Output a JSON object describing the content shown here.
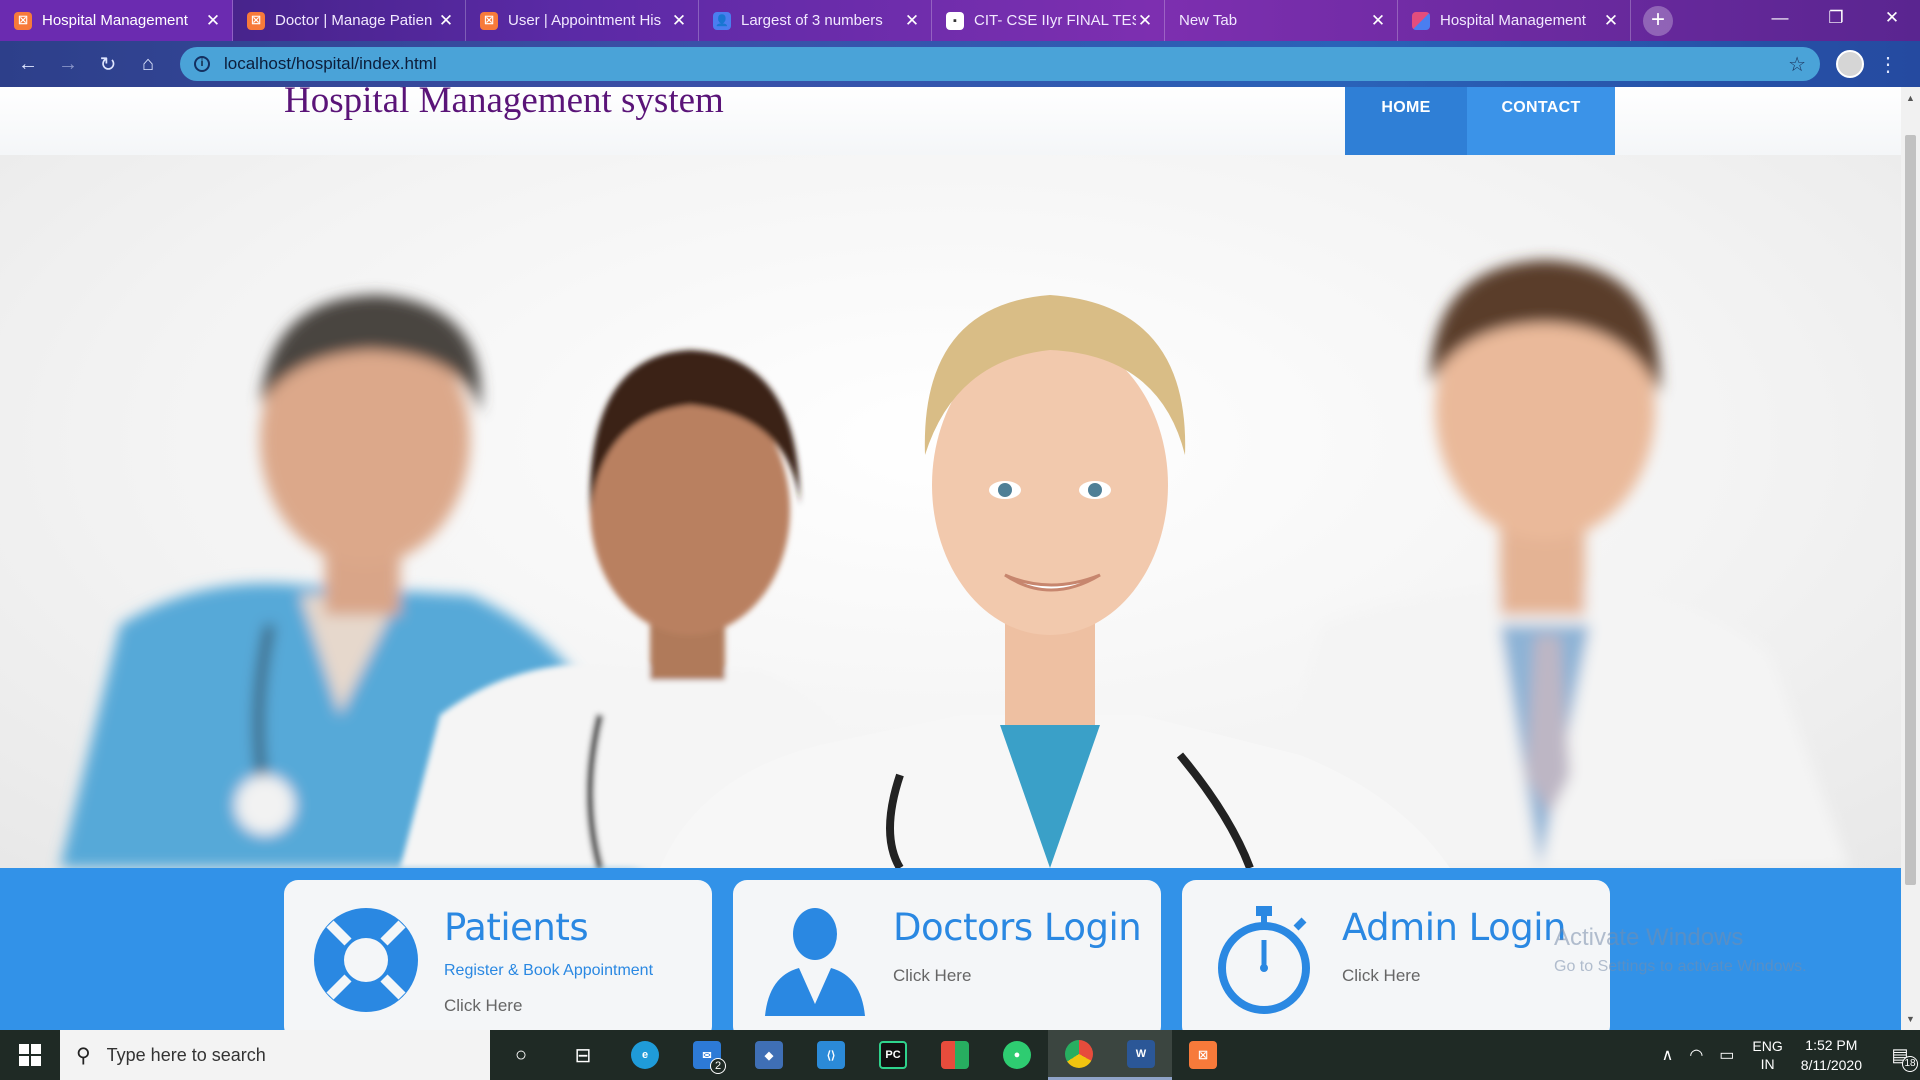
{
  "browser": {
    "tabs": [
      {
        "title": "Hospital Management",
        "favicon": "xampp-icon",
        "active": true
      },
      {
        "title": "Doctor | Manage Patien",
        "favicon": "xampp-icon",
        "active": false
      },
      {
        "title": "User | Appointment His",
        "favicon": "xampp-icon",
        "active": false
      },
      {
        "title": "Largest of 3 numbers",
        "favicon": "user-icon",
        "active": false
      },
      {
        "title": "CIT- CSE IIyr FINAL TES",
        "favicon": "document-icon",
        "active": false
      },
      {
        "title": "New Tab",
        "favicon": "",
        "active": false
      },
      {
        "title": "Hospital Management",
        "favicon": "hospital-icon",
        "active": false
      }
    ],
    "new_tab_symbol": "+",
    "url": "localhost/hospital/index.html"
  },
  "site": {
    "title": "Hospital Management system",
    "nav": {
      "home": "HOME",
      "contact": "CONTACT"
    }
  },
  "services": [
    {
      "title": "Patients",
      "subtitle": "Register & Book Appointment",
      "link": "Click Here",
      "icon": "lifebuoy-icon"
    },
    {
      "title": "Doctors Login",
      "subtitle": "",
      "link": "Click Here",
      "icon": "doctor-icon"
    },
    {
      "title": "Admin Login",
      "subtitle": "",
      "link": "Click Here",
      "icon": "stopwatch-icon"
    }
  ],
  "watermark": {
    "line1": "Activate Windows",
    "line2": "Go to Settings to activate Windows."
  },
  "taskbar": {
    "search_placeholder": "Type here to search",
    "mail_badge": "2",
    "language": "ENG",
    "region": "IN",
    "time": "1:52 PM",
    "date": "8/11/2020",
    "notification_count": "18"
  },
  "colors": {
    "accent_blue": "#3292e8",
    "title_purple": "#5a1478",
    "nav_home": "#2f7fd6",
    "nav_contact": "#3b93e8"
  }
}
